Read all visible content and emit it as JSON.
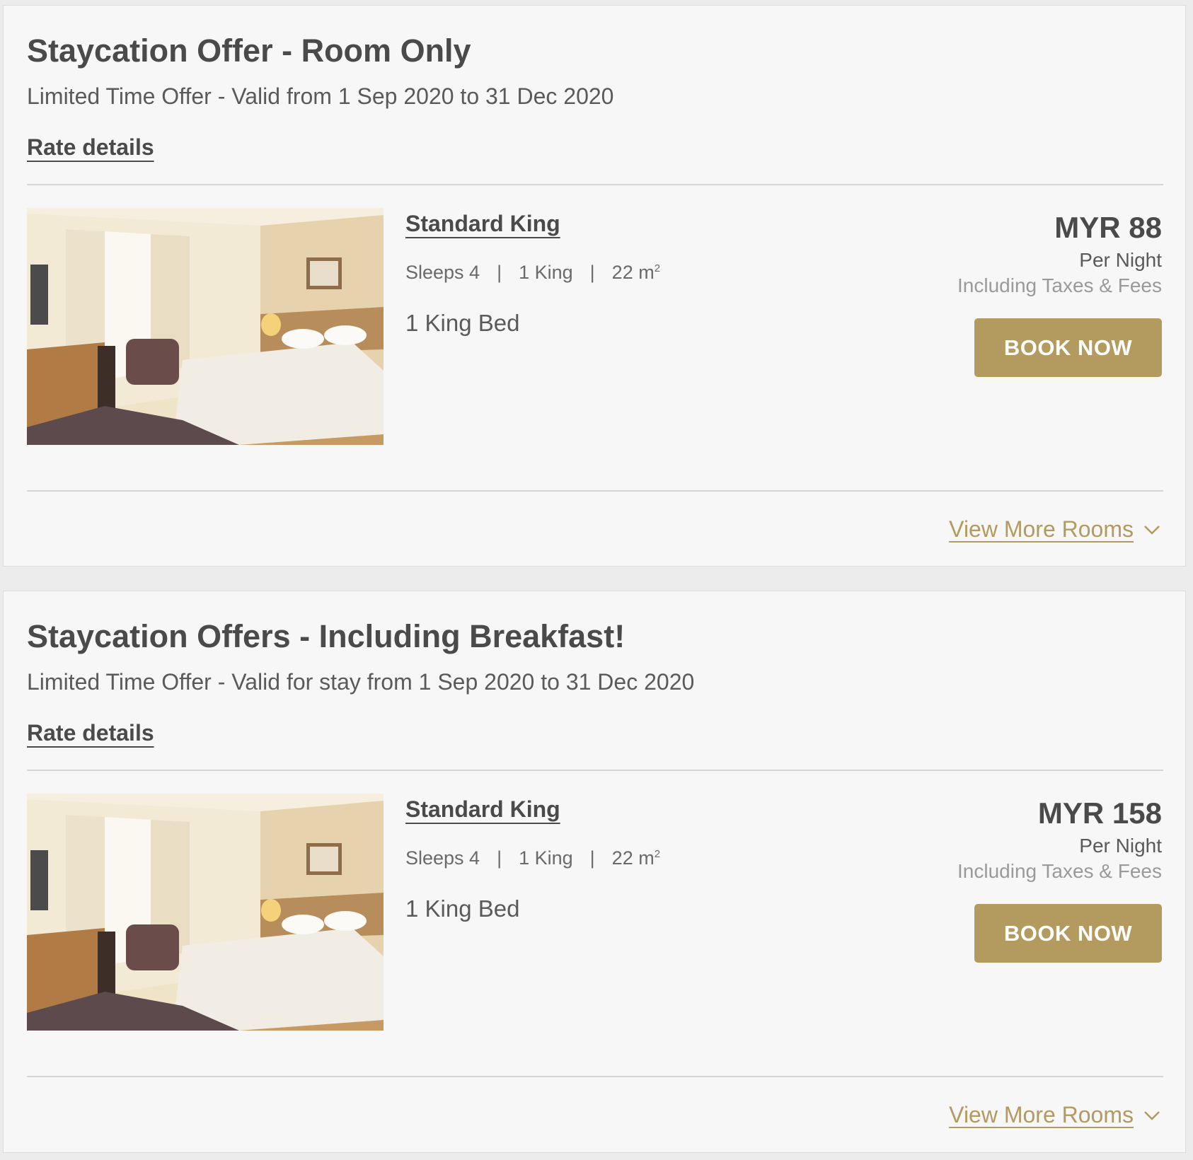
{
  "accent_color": "#b39a5e",
  "offers": [
    {
      "title": "Staycation Offer - Room Only",
      "subtitle": "Limited Time Offer - Valid from 1 Sep 2020 to 31 Dec 2020",
      "rate_details_label": "Rate details",
      "room": {
        "name": "Standard King",
        "sleeps": "Sleeps 4",
        "beds": "1 King",
        "size": "22 m",
        "size_sup": "2",
        "bed_type": "1 King Bed"
      },
      "price": "MYR 88",
      "per_night": "Per Night",
      "taxes": "Including Taxes & Fees",
      "book_label": "BOOK NOW",
      "view_more_label": "View More Rooms",
      "image_icon": "hotel-room-photo"
    },
    {
      "title": "Staycation Offers - Including Breakfast!",
      "subtitle": "Limited Time Offer - Valid for stay from 1 Sep 2020 to 31 Dec 2020",
      "rate_details_label": "Rate details",
      "room": {
        "name": "Standard King",
        "sleeps": "Sleeps 4",
        "beds": "1 King",
        "size": "22 m",
        "size_sup": "2",
        "bed_type": "1 King Bed"
      },
      "price": "MYR 158",
      "per_night": "Per Night",
      "taxes": "Including Taxes & Fees",
      "book_label": "BOOK NOW",
      "view_more_label": "View More Rooms",
      "image_icon": "hotel-room-photo"
    }
  ],
  "separator_glyph": "|",
  "chevron_icon": "chevron-down-icon"
}
